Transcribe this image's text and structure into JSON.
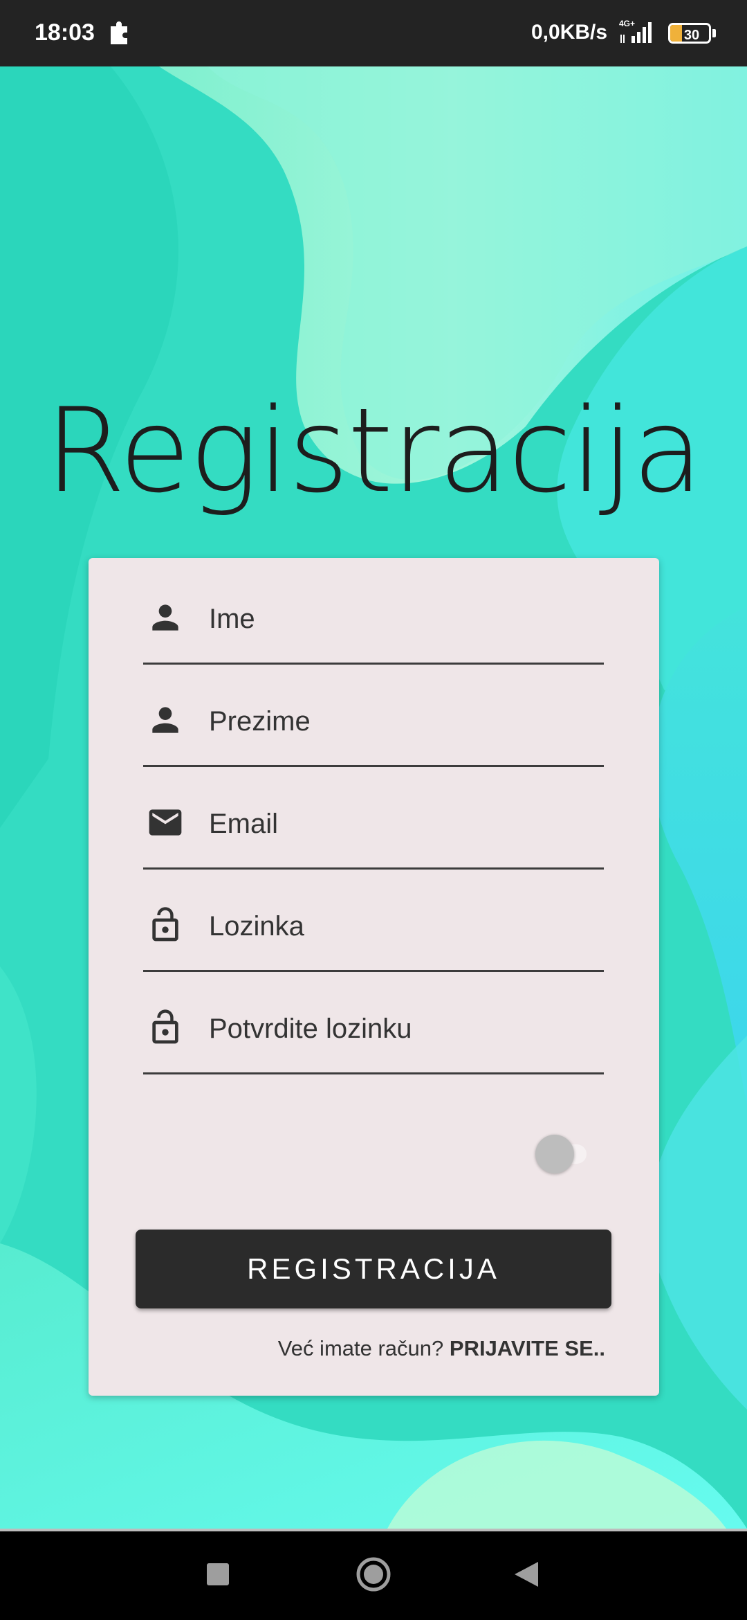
{
  "status_bar": {
    "time": "18:03",
    "speed": "0,0KB/s",
    "network": "4G+",
    "battery": "30",
    "battery_level": 0.3
  },
  "title": "Registracija",
  "form": {
    "fields": [
      {
        "label": "Ime",
        "icon": "person-icon"
      },
      {
        "label": "Prezime",
        "icon": "person-icon"
      },
      {
        "label": "Email",
        "icon": "mail-icon"
      },
      {
        "label": "Lozinka",
        "icon": "lock-open-icon"
      },
      {
        "label": "Potvrdite lozinku",
        "icon": "lock-open-icon"
      }
    ],
    "toggle_on": false,
    "register_button": "REGISTRACIJA",
    "login_prompt": "Već imate račun?",
    "login_link": "PRIJAVITE SE.."
  },
  "colors": {
    "card": "#efe6e8",
    "button": "#2b2b2b",
    "text": "#333333"
  }
}
